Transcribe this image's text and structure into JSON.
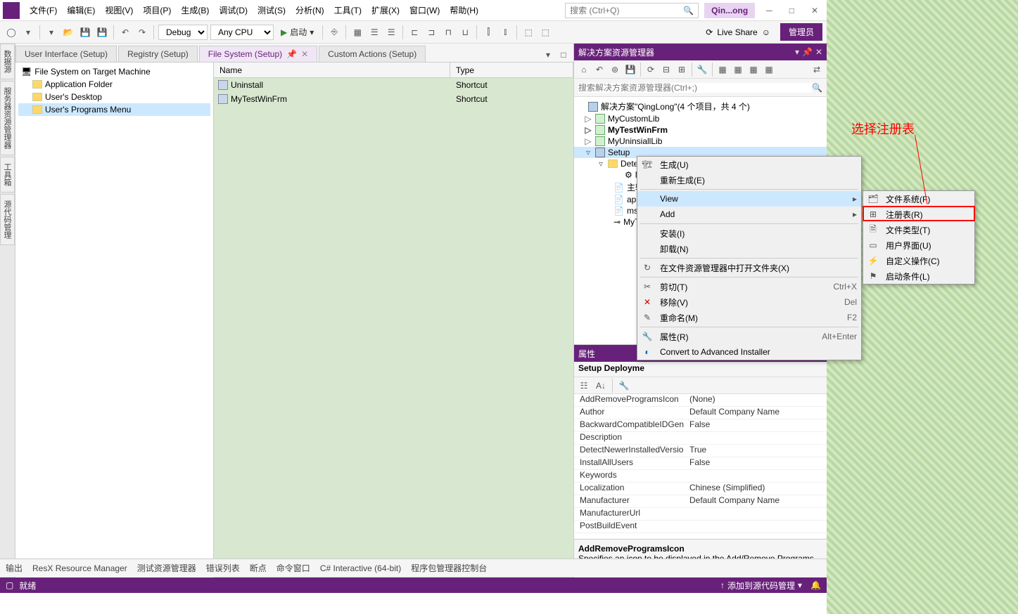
{
  "menu": {
    "file": "文件(F)",
    "edit": "编辑(E)",
    "view": "视图(V)",
    "project": "项目(P)",
    "build": "生成(B)",
    "debug": "调试(D)",
    "test": "测试(S)",
    "analyze": "分析(N)",
    "tools": "工具(T)",
    "extensions": "扩展(X)",
    "window": "窗口(W)",
    "help": "帮助(H)"
  },
  "search_placeholder": "搜索 (Ctrl+Q)",
  "project_badge": "Qin...ong",
  "toolbar": {
    "config": "Debug",
    "platform": "Any CPU",
    "start": "启动",
    "liveshare": "Live Share",
    "admin": "管理员"
  },
  "doctabs": {
    "t1": "User Interface (Setup)",
    "t2": "Registry (Setup)",
    "t3": "File System (Setup)",
    "t4": "Custom Actions (Setup)"
  },
  "left_tabs": {
    "a": "数据源",
    "b": "服务器资源管理器",
    "c": "工具箱",
    "d": "源代码管理"
  },
  "fs": {
    "root": "File System on Target Machine",
    "folders": {
      "app": "Application Folder",
      "desk": "User's Desktop",
      "prog": "User's Programs Menu"
    },
    "cols": {
      "name": "Name",
      "type": "Type"
    },
    "items": [
      {
        "name": "Uninstall",
        "type": "Shortcut"
      },
      {
        "name": "MyTestWinFrm",
        "type": "Shortcut"
      }
    ]
  },
  "sln": {
    "title": "解决方案资源管理器",
    "search_ph": "搜索解决方案资源管理器(Ctrl+;)",
    "root": "解决方案\"QingLong\"(4 个项目，共 4 个)",
    "nodes": {
      "lib1": "MyCustomLib",
      "frm": "MyTestWinFrm",
      "lib2": "MyUninsiallLib",
      "setup": "Setup",
      "detected": "Detec",
      "mi": "Mi",
      "out": "主输出",
      "appico": "app.ic",
      "msiex": "msiex",
      "myte": "MyTe"
    }
  },
  "ctx": {
    "build": "生成(U)",
    "rebuild": "重新生成(E)",
    "view": "View",
    "add": "Add",
    "install": "安装(I)",
    "uninstall": "卸载(N)",
    "openfolder": "在文件资源管理器中打开文件夹(X)",
    "cut": "剪切(T)",
    "remove": "移除(V)",
    "rename": "重命名(M)",
    "props": "属性(R)",
    "convert": "Convert to Advanced Installer",
    "sc_cut": "Ctrl+X",
    "sc_del": "Del",
    "sc_f2": "F2",
    "sc_props": "Alt+Enter",
    "sub": {
      "fs": "文件系统(F)",
      "reg": "注册表(R)",
      "ft": "文件类型(T)",
      "ui": "用户界面(U)",
      "ca": "自定义操作(C)",
      "lc": "启动条件(L)"
    }
  },
  "props": {
    "title": "属性",
    "subtitle": "Setup Deployme",
    "rows": [
      {
        "k": "AddRemoveProgramsIcon",
        "v": "(None)"
      },
      {
        "k": "Author",
        "v": "Default Company Name"
      },
      {
        "k": "BackwardCompatibleIDGen",
        "v": "False"
      },
      {
        "k": "Description",
        "v": ""
      },
      {
        "k": "DetectNewerInstalledVersio",
        "v": "True"
      },
      {
        "k": "InstallAllUsers",
        "v": "False"
      },
      {
        "k": "Keywords",
        "v": ""
      },
      {
        "k": "Localization",
        "v": "Chinese (Simplified)"
      },
      {
        "k": "Manufacturer",
        "v": "Default Company Name"
      },
      {
        "k": "ManufacturerUrl",
        "v": ""
      },
      {
        "k": "PostBuildEvent",
        "v": ""
      }
    ],
    "desc_title": "AddRemoveProgramsIcon",
    "desc_text": "Specifies an icon to be displayed in the Add/Remove Programs dialog box on the target computer"
  },
  "bottom": {
    "out": "输出",
    "resx": "ResX Resource Manager",
    "testres": "测试资源管理器",
    "errlist": "错误列表",
    "bp": "断点",
    "cmd": "命令窗口",
    "csi": "C# Interactive (64-bit)",
    "pkg": "程序包管理器控制台"
  },
  "status": {
    "ready": "就绪",
    "scm": "添加到源代码管理"
  },
  "annot": "选择注册表"
}
